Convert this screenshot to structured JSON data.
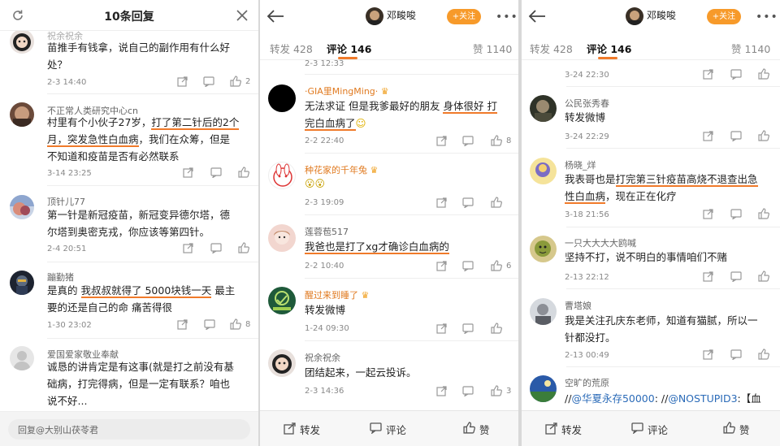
{
  "panel1": {
    "title": "10条回复",
    "partial_top_name": "祝余祝余",
    "comments": [
      {
        "text1": "苗推手有钱拿，说自己的副作用有什么好",
        "text2": "处？",
        "time": "2-3 14:40",
        "likes": "2"
      },
      {
        "name": "不正常人类研究中心cn",
        "text1a": "村里有个小伙子27岁，",
        "text1b": "打了第二针后的2个",
        "text2a": "月，",
        "text2b": "突发急性白血病",
        "text2c": "，我们在众筹，但是",
        "text3": "不知道和疫苗是否有必然联系",
        "time": "3-14 23:25",
        "likes": ""
      },
      {
        "name": "顶针儿77",
        "text1": "第一针是新冠疫苗，新冠变异德尔塔，德",
        "text2": "尔塔到奥密克戎，你应该等第四针。",
        "time": "2-4 20:51",
        "likes": ""
      },
      {
        "name": "蹦勤猪",
        "text1a": "是真的",
        "text1b": "我叔叔就得了 5000块钱一天",
        "text1c": "最主",
        "text2": "要的还是自己的命 痛苦得很",
        "time": "1-30 23:02",
        "likes": "8"
      },
      {
        "name": "爱国爱家敬业奉献",
        "text1": "诚恳的讲肯定是有这事(就是打之前没有基",
        "text2": "础病，打完得病，但是一定有联系？咱也",
        "text3": "说不好..."
      }
    ],
    "reply_placeholder": "回复@大别山茯苓君"
  },
  "panel2": {
    "author": "邓畯唆",
    "follow": "+关注",
    "tabs": [
      "转发 428",
      "评论 146",
      "赞 1140"
    ],
    "partial_time": "2-3 12:33",
    "comments": [
      {
        "name": "·GIA里MingMing·",
        "text1a": "无法求证 但是我爹最好的朋友",
        "text1b": "身体很好 打",
        "text2": "完白血病了",
        "time": "2-2 22:40",
        "likes": "8"
      },
      {
        "name": "种花家的千年兔",
        "text1": "",
        "time": "2-3 19:09",
        "likes": ""
      },
      {
        "name": "莲蓉苞517",
        "text1": "我爸也是打了xg才确诊白血病的",
        "time": "2-2 10:40",
        "likes": "6"
      },
      {
        "name": "醒过来到睡了",
        "text1": "转发微博",
        "time": "1-24 09:30",
        "likes": ""
      },
      {
        "name": "祝余祝余",
        "text1": "团结起来，一起云投诉。",
        "time": "2-3 14:36",
        "likes": "3"
      }
    ],
    "bottom": [
      "转发",
      "评论",
      "赞"
    ]
  },
  "panel3": {
    "author": "邓畯唆",
    "follow": "+关注",
    "tabs": [
      "转发 428",
      "评论 146",
      "赞 1140"
    ],
    "partial_time": "3-24 22:30",
    "comments": [
      {
        "name": "公民张秀春",
        "text1": "转发微博",
        "time": "3-24 22:29"
      },
      {
        "name": "杨晓_烊",
        "text1a": "我表哥也是",
        "text1b": "打完第三针疫苗高烧不退查出急",
        "text2a": "性白血病",
        "text2b": "，现在正在化疗",
        "time": "3-18 21:56"
      },
      {
        "name": "一只大大大大鸥喊",
        "text1": "坚持不打，说不明白的事情咱们不赌",
        "time": "2-13 22:12"
      },
      {
        "name": "曹塔娘",
        "text1": "我是关注孔庆东老师，知道有猫腻，所以一",
        "text2": "针都没打。",
        "time": "2-13 00:49"
      },
      {
        "name": "空旷的荒原",
        "text1a": "//",
        "text1b": "@华夏永存50000",
        "text1c": ": //",
        "text1d": "@NOSTUPID3",
        "text1e": ":【血"
      }
    ],
    "bottom": [
      "转发",
      "评论",
      "赞"
    ]
  },
  "colors": {
    "accent": "#f07a2a",
    "follow_bg": "#f79a2a",
    "link": "#2b6bb8"
  }
}
